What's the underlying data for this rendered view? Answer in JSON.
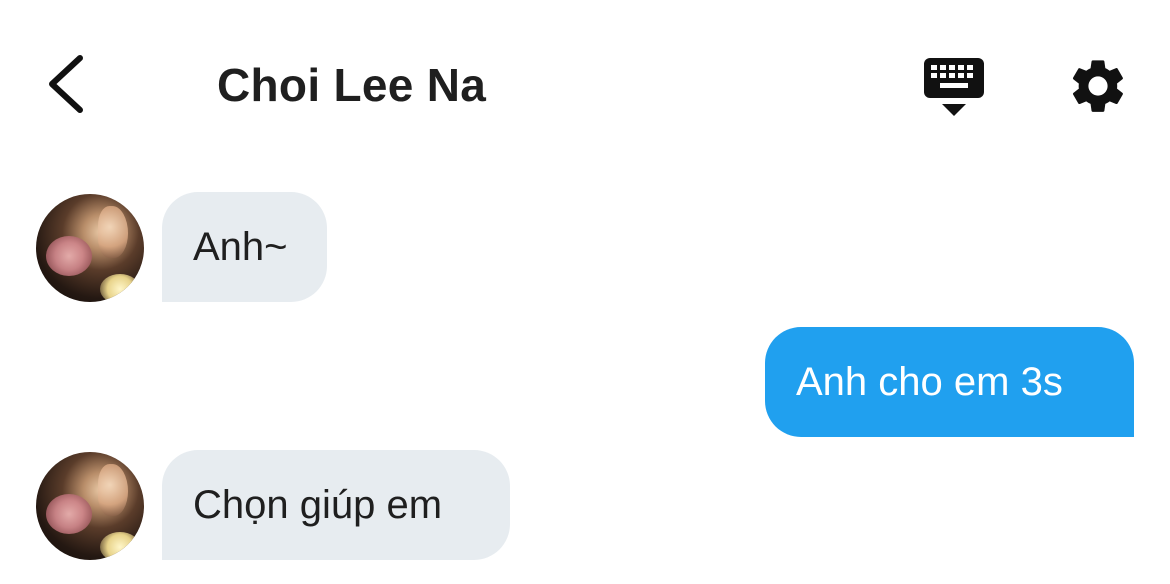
{
  "header": {
    "title": "Choi Lee Na",
    "icons": {
      "back": "chevron-left-icon",
      "keyboard": "keyboard-hide-icon",
      "settings": "gear-icon"
    }
  },
  "messages": [
    {
      "direction": "incoming",
      "text": "Anh~"
    },
    {
      "direction": "outgoing",
      "text": "Anh cho em 3s"
    },
    {
      "direction": "incoming",
      "text": "Chọn giúp em"
    }
  ],
  "colors": {
    "outgoing_bubble": "#20a0ef",
    "incoming_bubble": "#e7ecf0",
    "text": "#1f1f1f"
  }
}
